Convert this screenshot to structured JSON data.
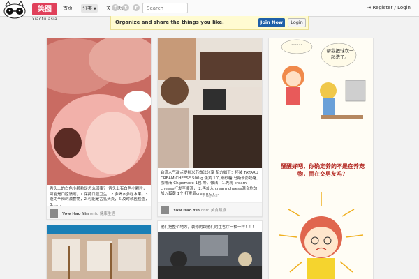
{
  "header": {
    "brand": "笑图",
    "brand_sub": "xiaotu.asia",
    "nav": [
      {
        "label": "首页"
      },
      {
        "label": "分类",
        "caret": "▼"
      },
      {
        "label": "关于我们"
      }
    ],
    "social": [
      {
        "icon": "facebook-icon",
        "glyph": "f"
      },
      {
        "icon": "twitter-icon",
        "glyph": "t"
      },
      {
        "icon": "rss-icon",
        "glyph": "r"
      }
    ],
    "search_placeholder": "Search",
    "auth_label": "Register / Login"
  },
  "banner": {
    "text": "Organize and share the things you like.",
    "join_label": "Join Now",
    "login_label": "Login"
  },
  "pins": {
    "p1": {
      "desc": "舌头上的白色小颗粒是怎么回事？ 舌头上有白色小颗粒，可能是口腔溃疡，1.保持口腔卫生，2.多喝水多吃水果，3.避免辛辣刺激食物，2.可能是舌乳头炎，5.及时就医检查，3.……",
      "user": "Yow Hao Yin",
      "onto": "onto",
      "board": "健康生活"
    },
    "p2": {
      "desc": "台湾人气甜点提拉米苏做法分享 配方如下：杯装 TATARU CREAM CHEESE 500 g 蛋黄 1个,细砂糖,马斯卡彭奶酪,咖啡液 Chipsmore 1包 等。做法：1.先将 cream cheese打发至顺滑， 2.再加入 cream cheese混合均匀,加入蛋黄 1个,打发后cream ch ...",
      "repins": "2 repins",
      "user": "Yow Hao Yin",
      "onto": "onto",
      "board": "美食甜点"
    },
    "p3": {
      "bubble_top": "......",
      "bubble_right": "帮我把球衣一起洗了。",
      "caption": "醒醒好吧，你确定养的不是在养宠物，而在交男友吗？"
    },
    "p5": {
      "title": "他们把整个地方，装修的跟他们的主客厅一模一样！！！"
    }
  },
  "colors": {
    "brand": "#e0405a",
    "join": "#1f5fa8",
    "banner_bg": "#fffbd1"
  }
}
